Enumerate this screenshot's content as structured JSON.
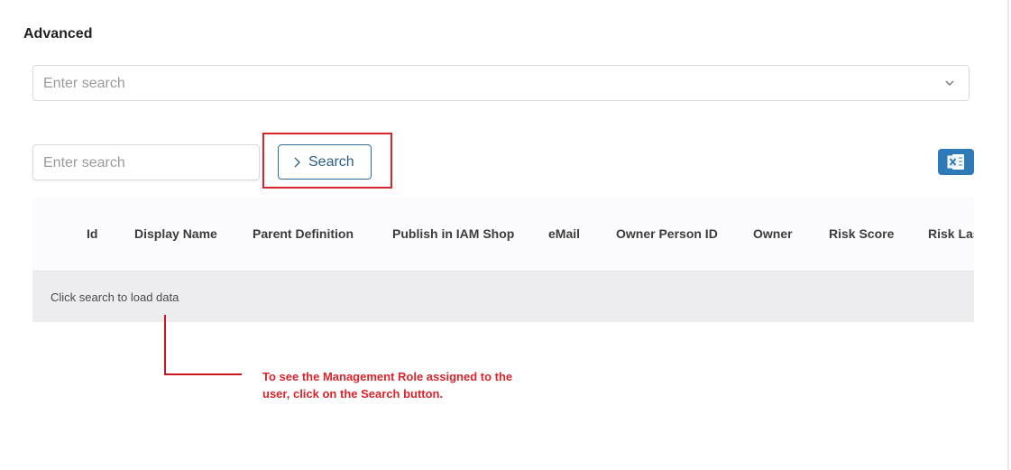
{
  "section": {
    "title": "Advanced"
  },
  "top_select": {
    "placeholder": "Enter search"
  },
  "filter": {
    "placeholder": "Enter search",
    "search_label": "Search"
  },
  "table": {
    "columns": [
      "Id",
      "Display Name",
      "Parent Definition",
      "Publish in IAM Shop",
      "eMail",
      "Owner Person ID",
      "Owner",
      "Risk Score",
      "Risk Las"
    ],
    "empty_message": "Click search to load data"
  },
  "annotation": {
    "text": "To see the Management Role assigned to the user, click on the Search button."
  },
  "colors": {
    "accent": "#2e7ab8",
    "annotation": "#d9242b"
  },
  "icons": {
    "select": "chevron-down-icon",
    "button": "chevron-right-icon",
    "export": "excel-icon"
  }
}
